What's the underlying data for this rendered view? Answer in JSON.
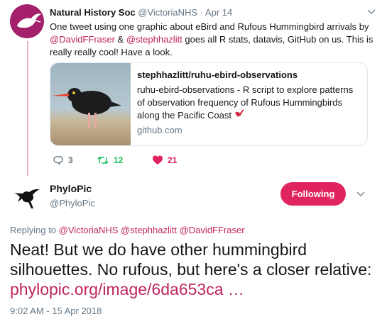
{
  "tweet1": {
    "name": "Natural History Soc",
    "handle": "@VictoriaNHS",
    "separator": "·",
    "date": "Apr 14",
    "text_part1": "One tweet using one graphic about eBird and Rufous Hummingbird arrivals by ",
    "mention1": "@DavidFFraser",
    "text_part2": " & ",
    "mention2": "@stephhazlitt",
    "text_part3": " goes all R stats, datavis, GitHub on us. This is really really cool! Have a look.",
    "card": {
      "title": "stephhazlitt/ruhu-ebird-observations",
      "description": "ruhu-ebird-observations - R script to explore patterns of observation frequency of Rufous Hummingbirds along the Pacific Coast",
      "domain": "github.com"
    },
    "actions": {
      "replies": "3",
      "retweets": "12",
      "likes": "21"
    },
    "colors": {
      "avatar_bg": "#a5206b",
      "mention": "#c0245f",
      "retweet": "#17bf63",
      "like": "#e0245e"
    }
  },
  "tweet2": {
    "name": "PhyloPic",
    "handle": "@PhyloPic",
    "follow_label": "Following",
    "replying_prefix": "Replying to",
    "replying_to": "@VictoriaNHS @stephhazlitt @DavidFFraser",
    "text": "Neat! But we do have other hummingbird silhouettes. No rufous, but here's a closer relative: ",
    "link": "phylopic.org/image/6da653ca …",
    "timestamp": "9:02 AM - 15 Apr 2018",
    "colors": {
      "follow_bg": "#e0245e"
    }
  }
}
